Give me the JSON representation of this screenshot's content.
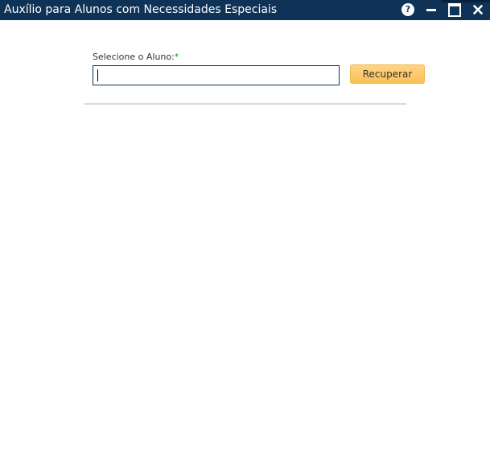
{
  "window": {
    "title": "Auxílio para Alunos com Necessidades Especiais",
    "controls": {
      "help_glyph": "?",
      "close_glyph": "✕"
    }
  },
  "form": {
    "student_label": "Selecione o Aluno:",
    "required_marker": "*",
    "student_value": "",
    "recover_button": "Recuperar"
  },
  "colors": {
    "titlebar": "#0f3257",
    "button_accent": "#fbbf55",
    "required": "#2e8b2e"
  }
}
